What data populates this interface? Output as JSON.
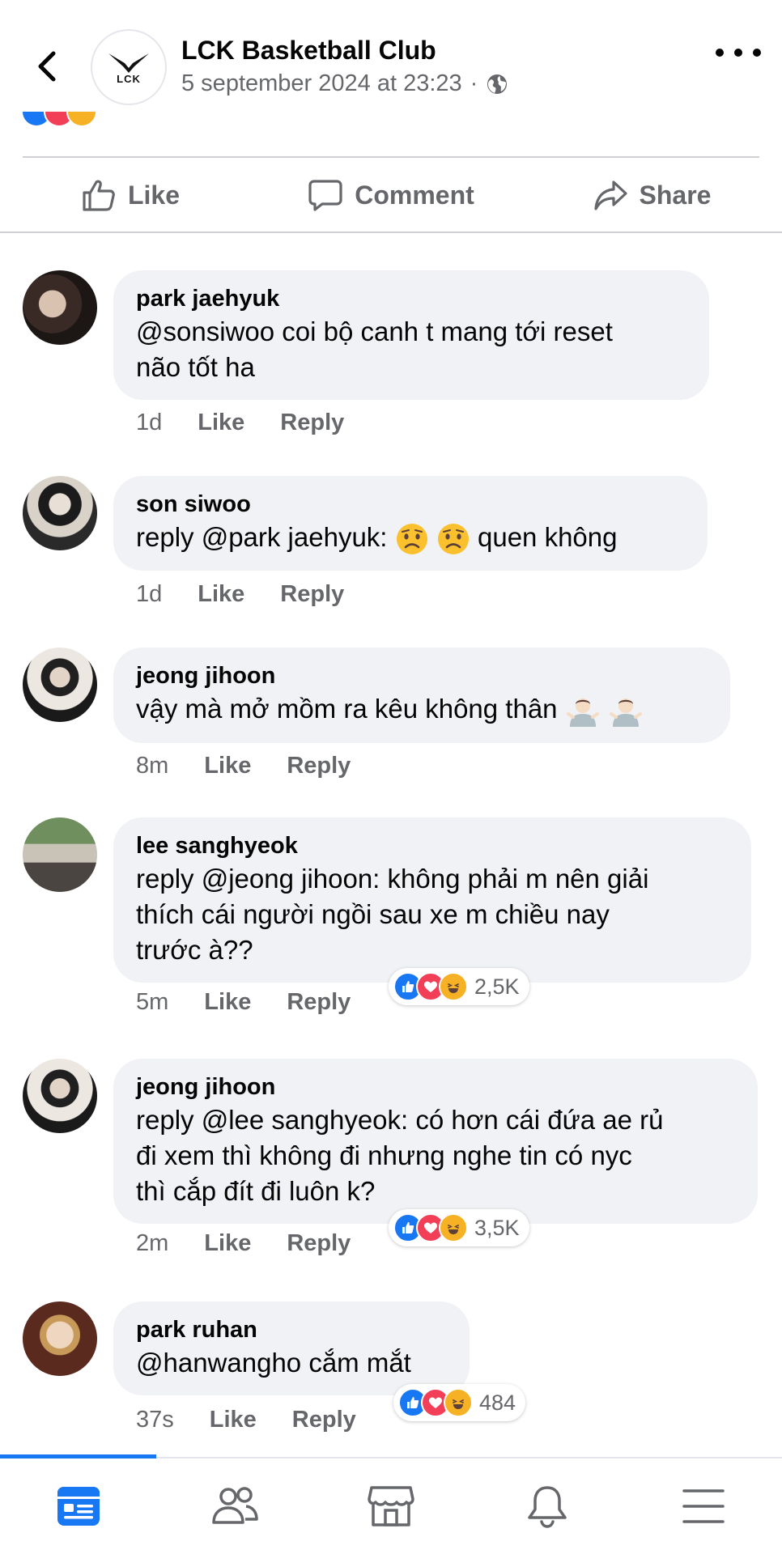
{
  "header": {
    "page_name": "LCK Basketball Club",
    "post_time": "5 september 2024 at 23:23",
    "separator": "·",
    "logo_text": "LCK",
    "back_icon": "chevron-left-icon",
    "privacy_icon": "globe-icon",
    "more_icon": "more-horizontal-icon"
  },
  "post_actions": {
    "like": "Like",
    "comment": "Comment",
    "share": "Share"
  },
  "comments": [
    {
      "name": "park jaehyuk",
      "lines": [
        "@sonsiwoo coi bộ canh t mang tới reset",
        "não tốt ha"
      ],
      "time": "1d",
      "like": "Like",
      "reply": "Reply"
    },
    {
      "name": "son siwoo",
      "text_before": "reply @park jaehyuk:",
      "emoji": "worried-face-emoji",
      "text_after": "quen không",
      "time": "1d",
      "like": "Like",
      "reply": "Reply"
    },
    {
      "name": "jeong jihoon",
      "text": "vậy mà mở mồm ra kêu không thân",
      "emoji": "person-shrugging-emoji",
      "time": "8m",
      "like": "Like",
      "reply": "Reply"
    },
    {
      "name": "lee sanghyeok",
      "lines": [
        "reply @jeong jihoon: không phải m nên giải",
        "thích cái người ngồi sau xe m chiều nay",
        "trước à??"
      ],
      "time": "5m",
      "like": "Like",
      "reply": "Reply",
      "reaction_count": "2,5K"
    },
    {
      "name": "jeong jihoon",
      "lines": [
        "reply @lee sanghyeok: có hơn cái đứa ae rủ",
        "đi xem thì không đi nhưng nghe tin có nyc",
        "thì cắp đít đi luôn k?"
      ],
      "time": "2m",
      "like": "Like",
      "reply": "Reply",
      "reaction_count": "3,5K"
    },
    {
      "name": "park ruhan",
      "text": "@hanwangho cắm mắt",
      "time": "37s",
      "like": "Like",
      "reply": "Reply",
      "reaction_count": "484"
    }
  ],
  "bottom_nav": {
    "active": "feed",
    "items": [
      "feed-icon",
      "friends-icon",
      "marketplace-icon",
      "notifications-icon",
      "menu-icon"
    ]
  },
  "colors": {
    "accent": "#1877f2",
    "bubble": "#f0f2f5",
    "secondary_text": "#65676b",
    "love": "#f33e58",
    "haha": "#f7b125"
  }
}
